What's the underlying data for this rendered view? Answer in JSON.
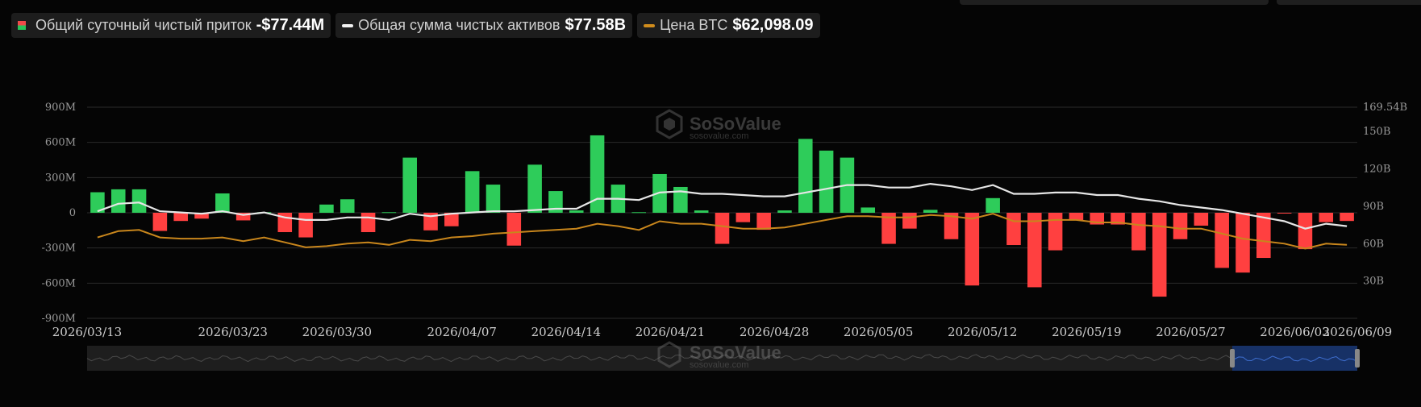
{
  "legend": {
    "inflow_label": "Общий суточный чистый приток",
    "inflow_value": "-$77.44M",
    "assets_label": "Общая сумма чистых активов",
    "assets_value": "$77.58B",
    "btc_label": "Цена BTC",
    "btc_value": "$62,098.09"
  },
  "watermark": {
    "brand": "SoSoValue",
    "site": "sosovalue.com"
  },
  "colors": {
    "positive": "#2ecc5a",
    "negative": "#ff4040",
    "assets_line": "#e6e6e6",
    "btc_line": "#c8861c",
    "grid": "#2a2a2a"
  },
  "chart_data": {
    "type": "bar",
    "left_axis": {
      "ticks": [
        "900M",
        "600M",
        "300M",
        "0",
        "-300M",
        "-600M",
        "-900M"
      ],
      "ylim": [
        -900,
        900
      ],
      "unit": "M USD"
    },
    "right_axis": {
      "ticks": [
        "169.54B",
        "150B",
        "120B",
        "90B",
        "60B",
        "30B"
      ],
      "ylim": [
        0,
        169.54
      ],
      "unit": "B USD"
    },
    "x_ticks": [
      "2026/03/13",
      "2026/03/23",
      "2026/03/30",
      "2026/04/07",
      "2026/04/14",
      "2026/04/21",
      "2026/04/28",
      "2026/05/05",
      "2026/05/12",
      "2026/05/19",
      "2026/05/27",
      "2026/06/03",
      "2026/06/09"
    ],
    "series": [
      {
        "name": "Общий суточный чистый приток",
        "type": "bar",
        "values": [
          175,
          200,
          200,
          -155,
          -70,
          -50,
          165,
          -65,
          5,
          -165,
          -210,
          70,
          115,
          -165,
          5,
          470,
          -150,
          -115,
          355,
          240,
          -280,
          410,
          185,
          20,
          660,
          240,
          5,
          330,
          220,
          20,
          -265,
          -80,
          -145,
          20,
          630,
          530,
          470,
          45,
          -265,
          -135,
          25,
          -225,
          -620,
          125,
          -275,
          -635,
          -320,
          -65,
          -100,
          -100,
          -320,
          -715,
          -225,
          -110,
          -470,
          -510,
          -385,
          -5,
          -310,
          -80,
          -70
        ]
      },
      {
        "name": "Общая сумма чистых активов",
        "type": "line",
        "values": [
          86,
          92,
          93,
          86,
          85,
          84,
          86,
          83,
          85,
          81,
          79,
          79,
          81,
          81,
          79,
          84,
          82,
          84,
          85,
          86,
          86,
          87,
          88,
          88,
          96,
          96,
          95,
          101,
          102,
          100,
          100,
          99,
          98,
          98,
          101,
          104,
          107,
          107,
          105,
          105,
          108,
          106,
          103,
          107,
          100,
          100,
          101,
          101,
          99,
          99,
          96,
          94,
          91,
          89,
          87,
          84,
          81,
          78,
          72,
          76,
          74
        ]
      },
      {
        "name": "Цена BTC",
        "type": "line",
        "values": [
          65,
          70,
          71,
          65,
          64,
          64,
          65,
          62,
          65,
          61,
          57,
          58,
          60,
          61,
          59,
          63,
          62,
          65,
          66,
          68,
          69,
          70,
          71,
          72,
          76,
          74,
          71,
          78,
          76,
          76,
          74,
          72,
          72,
          73,
          76,
          79,
          82,
          82,
          81,
          81,
          83,
          82,
          80,
          84,
          78,
          78,
          79,
          79,
          77,
          77,
          75,
          74,
          72,
          72,
          68,
          64,
          62,
          60,
          56,
          60,
          59
        ]
      }
    ]
  }
}
